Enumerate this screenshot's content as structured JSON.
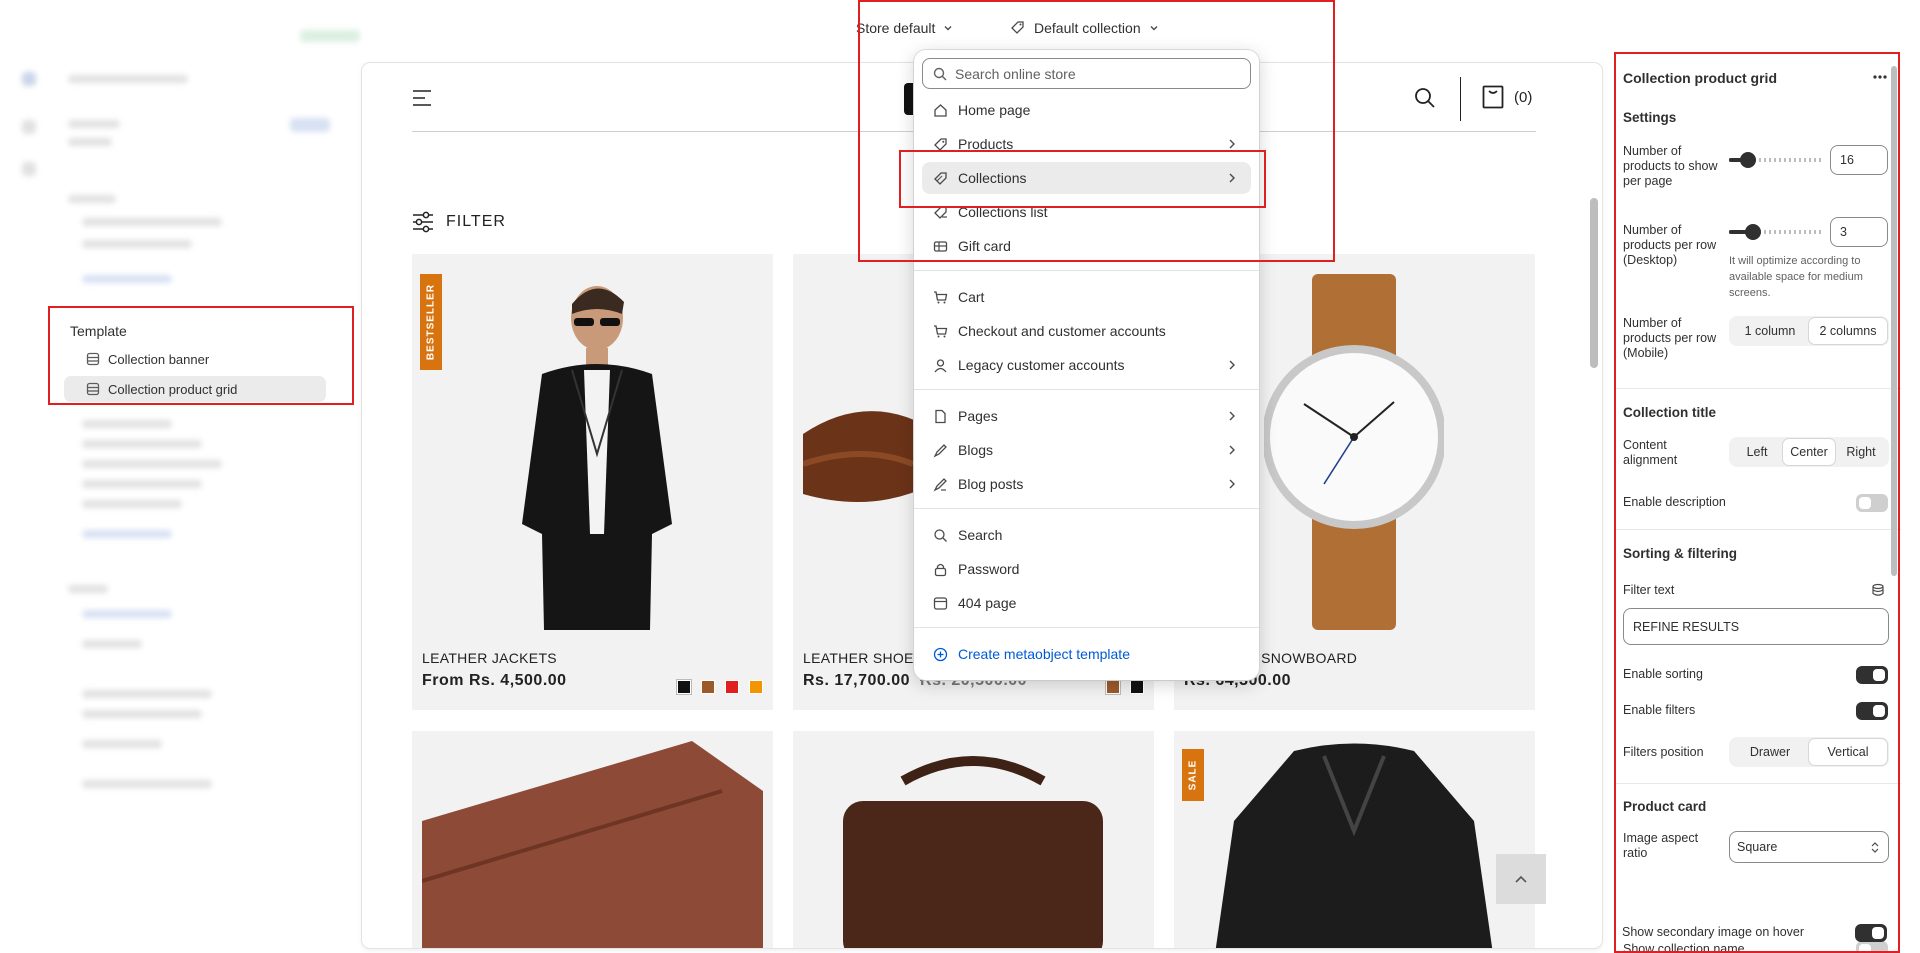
{
  "topbar": {
    "store_selector": "Store default",
    "template_selector": "Default collection"
  },
  "sidebar": {
    "section_title": "Template",
    "items": [
      {
        "label": "Collection banner"
      },
      {
        "label": "Collection product grid"
      }
    ]
  },
  "preview": {
    "cart_count": "(0)",
    "filter_label": "FILTER",
    "products": [
      {
        "name": "LEATHER JACKETS",
        "price": "From Rs. 4,500.00",
        "badge": "BESTSELLER",
        "swatches": [
          "#111111",
          "#9c5a2b",
          "#e02020",
          "#f29500"
        ]
      },
      {
        "name": "LEATHER SHOES",
        "price": "Rs. 17,700.00",
        "compare_price": "Rs. 20,500.00",
        "swatches": [
          "#9c5a2b",
          "#111111"
        ]
      },
      {
        "name": "LOCATION SNOWBOARD",
        "price": "Rs. 64,300.00"
      },
      {
        "name": "",
        "price": ""
      },
      {
        "name": "",
        "price": ""
      },
      {
        "name": "",
        "price": "",
        "badge": "SALE"
      }
    ]
  },
  "dropdown": {
    "search_placeholder": "Search online store",
    "items": [
      {
        "label": "Home page",
        "icon": "home-icon"
      },
      {
        "label": "Products",
        "icon": "tag-icon"
      },
      {
        "label": "Collections",
        "icon": "collection-icon"
      },
      {
        "label": "Collections list",
        "icon": "collections-list-icon"
      },
      {
        "label": "Gift card",
        "icon": "gift-card-icon"
      },
      {
        "label": "Cart",
        "icon": "cart-icon"
      },
      {
        "label": "Checkout and customer accounts",
        "icon": "cart-icon"
      },
      {
        "label": "Legacy customer accounts",
        "icon": "person-icon"
      },
      {
        "label": "Pages",
        "icon": "page-icon"
      },
      {
        "label": "Blogs",
        "icon": "blog-icon"
      },
      {
        "label": "Blog posts",
        "icon": "blog-post-icon"
      },
      {
        "label": "Search",
        "icon": "search-icon"
      },
      {
        "label": "Password",
        "icon": "lock-icon"
      },
      {
        "label": "404 page",
        "icon": "404-icon"
      }
    ],
    "create_label": "Create metaobject template"
  },
  "panel": {
    "title": "Collection product grid",
    "settings_heading": "Settings",
    "products_per_page_label": "Number of products to show per page",
    "products_per_page_value": "16",
    "products_per_page_level": 0.2,
    "products_per_row_label": "Number of products per row (Desktop)",
    "products_per_row_value": "3",
    "products_per_row_level": 0.25,
    "products_per_row_help": "It will optimize according to available space for medium screens.",
    "mobile_label": "Number of products per row (Mobile)",
    "mobile_options": [
      "1 column",
      "2 columns"
    ],
    "collection_title_heading": "Collection title",
    "alignment_label": "Content alignment",
    "alignment_options": [
      "Left",
      "Center",
      "Right"
    ],
    "enable_description_label": "Enable description",
    "sorting_heading": "Sorting & filtering",
    "filter_text_label": "Filter text",
    "filter_text_value": "REFINE RESULTS",
    "enable_sorting_label": "Enable sorting",
    "enable_filters_label": "Enable filters",
    "filters_position_label": "Filters position",
    "filters_position_options": [
      "Drawer",
      "Vertical"
    ],
    "product_card_heading": "Product card",
    "aspect_ratio_label": "Image aspect ratio",
    "aspect_ratio_value": "Square",
    "show_collection_name_label": "Show collection name",
    "secondary_image_label": "Show secondary image on hover"
  },
  "colors": {
    "accent": "#e02020",
    "badge": "#d8740f",
    "link": "#005bd3"
  }
}
